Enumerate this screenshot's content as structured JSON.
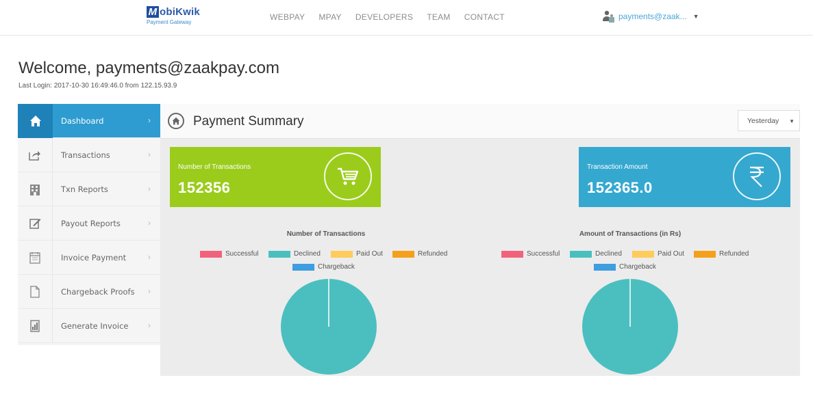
{
  "header": {
    "logo_text": "obiKwik",
    "logo_sub": "Payment Gateway",
    "nav": [
      "WEBPAY",
      "MPAY",
      "DEVELOPERS",
      "TEAM",
      "CONTACT"
    ],
    "user": "payments@zaak..."
  },
  "welcome": {
    "title": "Welcome, payments@zaakpay.com",
    "last_login": "Last Login: 2017-10-30 16:49:46.0 from 122.15.93.9"
  },
  "sidebar": {
    "items": [
      {
        "label": "Dashboard",
        "icon": "home-icon",
        "active": true
      },
      {
        "label": "Transactions",
        "icon": "share-icon"
      },
      {
        "label": "Txn Reports",
        "icon": "building-icon"
      },
      {
        "label": "Payout Reports",
        "icon": "edit-icon"
      },
      {
        "label": "Invoice Payment",
        "icon": "calendar-icon"
      },
      {
        "label": "Chargeback Proofs",
        "icon": "document-icon"
      },
      {
        "label": "Generate Invoice",
        "icon": "report-icon"
      }
    ]
  },
  "main": {
    "title": "Payment Summary",
    "period_select": "Yesterday",
    "cards": [
      {
        "label": "Number of Transactions",
        "value": "152356",
        "icon": "cart-icon",
        "color": "#9bcc1c"
      },
      {
        "label": "Transaction Amount",
        "value": "152365.0",
        "icon": "rupee-icon",
        "color": "#35a8cf"
      }
    ]
  },
  "legend_colors": {
    "Successful": "#f0637a",
    "Declined": "#4bbfbf",
    "Paid Out": "#fdcc5a",
    "Refunded": "#f4a01c",
    "Chargeback": "#3e9ee0"
  },
  "chart_data": [
    {
      "type": "pie",
      "title": "Number of Transactions",
      "labels": [
        "Successful",
        "Declined",
        "Paid Out",
        "Refunded",
        "Chargeback"
      ],
      "values": [
        0,
        1,
        0,
        0,
        0
      ],
      "legend": "top"
    },
    {
      "type": "pie",
      "title": "Amount of Transactions (in Rs)",
      "labels": [
        "Successful",
        "Declined",
        "Paid Out",
        "Refunded",
        "Chargeback"
      ],
      "values": [
        0,
        1,
        0,
        0,
        0
      ],
      "legend": "top"
    }
  ]
}
